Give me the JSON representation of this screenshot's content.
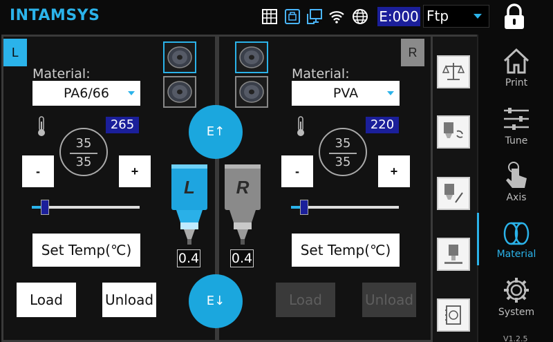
{
  "header": {
    "brand": "INTAMSYS",
    "e_counter": "E:000",
    "transfer_mode": "Ftp",
    "icons": [
      "grid-icon",
      "camera-icon",
      "network-icon",
      "wifi-icon",
      "globe-icon",
      "lock-icon"
    ]
  },
  "left_extruder": {
    "tag": "L",
    "material_label": "Material:",
    "material": "PA6/66",
    "target_temp": "265",
    "current_temp": "35",
    "set_temp": "35",
    "decrement": "-",
    "increment": "+",
    "set_temp_button": "Set Temp(℃)",
    "load_button": "Load",
    "unload_button": "Unload",
    "nozzle_label": "L",
    "nozzle_size": "0.4",
    "slider_level": 0.12,
    "load_enabled": true
  },
  "right_extruder": {
    "tag": "R",
    "material_label": "Material:",
    "material": "PVA",
    "target_temp": "220",
    "current_temp": "35",
    "set_temp": "35",
    "decrement": "-",
    "increment": "+",
    "set_temp_button": "Set Temp(℃)",
    "load_button": "Load",
    "unload_button": "Unload",
    "nozzle_label": "R",
    "nozzle_size": "0.4",
    "slider_level": 0.12,
    "load_enabled": false
  },
  "center": {
    "extrude_up": "E↑",
    "extrude_down": "E↓"
  },
  "nav": {
    "items": [
      {
        "label": "Print",
        "icon": "home-icon"
      },
      {
        "label": "Tune",
        "icon": "sliders-icon"
      },
      {
        "label": "Axis",
        "icon": "hand-icon"
      },
      {
        "label": "Material",
        "icon": "spools-icon"
      },
      {
        "label": "System",
        "icon": "gear-icon"
      }
    ],
    "active": "Material",
    "version": "V1.2.5"
  },
  "colors": {
    "accent": "#2bb3ea",
    "indicator": "#1b1f9a",
    "background": "#0b0b0b",
    "disabled": "#3a3a3a"
  }
}
